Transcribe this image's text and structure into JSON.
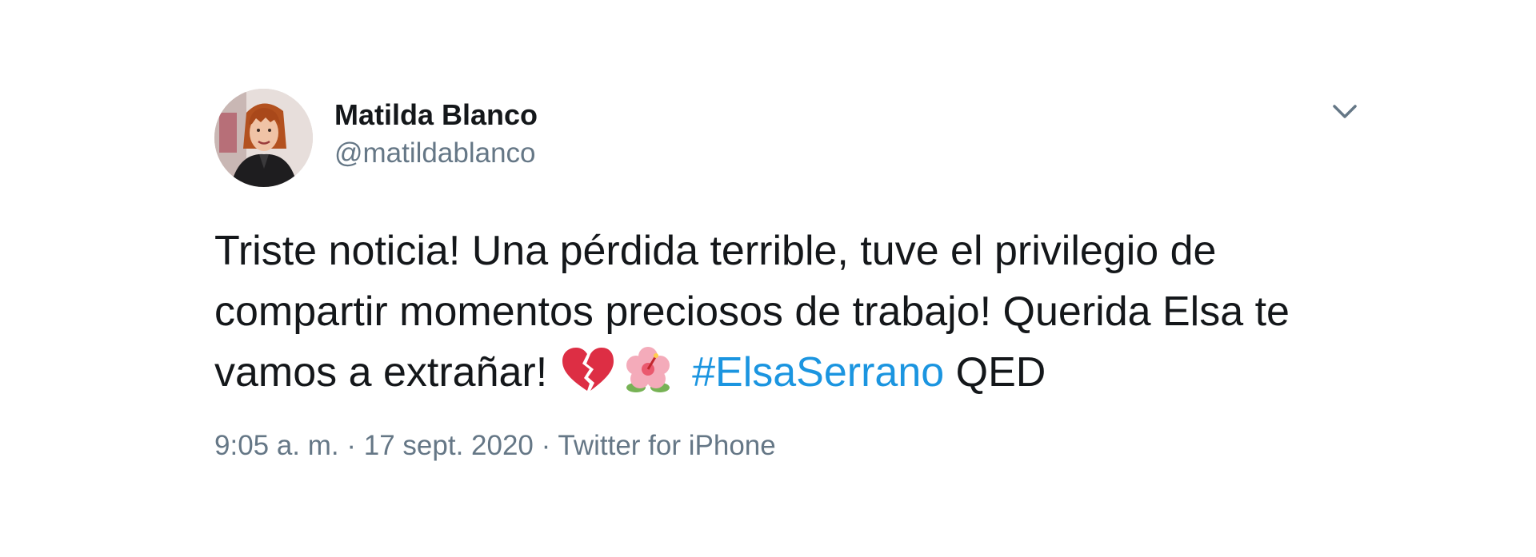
{
  "author": {
    "name": "Matilda Blanco",
    "handle": "@matildablanco",
    "avatar_icon": "profile-photo"
  },
  "menu": {
    "icon": "chevron-down-icon"
  },
  "tweet": {
    "text_before_emoji": "Triste noticia! Una pérdida terrible, tuve el privilegio de compartir momentos preciosos de trabajo! Querida Elsa te vamos a extrañar!",
    "emojis": [
      "broken-heart-emoji",
      "hibiscus-emoji"
    ],
    "hashtag": "#ElsaSerrano",
    "text_after_hashtag": "QED"
  },
  "meta": {
    "time": "9:05 a. m.",
    "separator": "·",
    "date": "17 sept. 2020",
    "source": "Twitter for iPhone"
  },
  "colors": {
    "text": "#14171a",
    "secondary": "#657786",
    "link": "#1b95e0",
    "broken_heart": "#dd2e44",
    "hibiscus": "#f4abba"
  }
}
